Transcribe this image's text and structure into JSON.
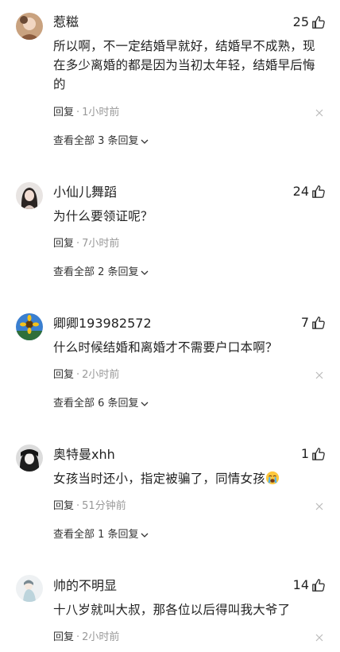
{
  "comments": [
    {
      "username": "惹糍",
      "likes": "25",
      "text": "所以啊，不一定结婚早就好，结婚早不成熟，现在多少离婚的都是因为当初太年轻，结婚早后悔的",
      "reply_label": "回复",
      "time": "1小时前",
      "view_replies": "查看全部 3 条回复"
    },
    {
      "username": "小仙儿舞蹈",
      "likes": "24",
      "text": "为什么要领证呢？",
      "reply_label": "回复",
      "time": "7小时前",
      "view_replies": "查看全部 2 条回复"
    },
    {
      "username": "卿卿193982572",
      "likes": "7",
      "text": "什么时候结婚和离婚才不需要户口本啊？",
      "reply_label": "回复",
      "time": "2小时前",
      "view_replies": "查看全部 6 条回复"
    },
    {
      "username": "奥特曼xhh",
      "likes": "1",
      "text": "女孩当时还小，指定被骗了，同情女孩",
      "reply_label": "回复",
      "time": "51分钟前",
      "view_replies": "查看全部 1 条回复"
    },
    {
      "username": "帅的不明显",
      "likes": "14",
      "text": "十八岁就叫大叔，那各位以后得叫我大爷了",
      "reply_label": "回复",
      "time": "2小时前"
    }
  ],
  "icons": {
    "like": "thumb-up-icon",
    "close": "close-icon",
    "expand": "chevron-down-icon",
    "crying_emoji": "crying-face-emoji"
  },
  "colors": {
    "text": "#222222",
    "muted": "#999999"
  }
}
